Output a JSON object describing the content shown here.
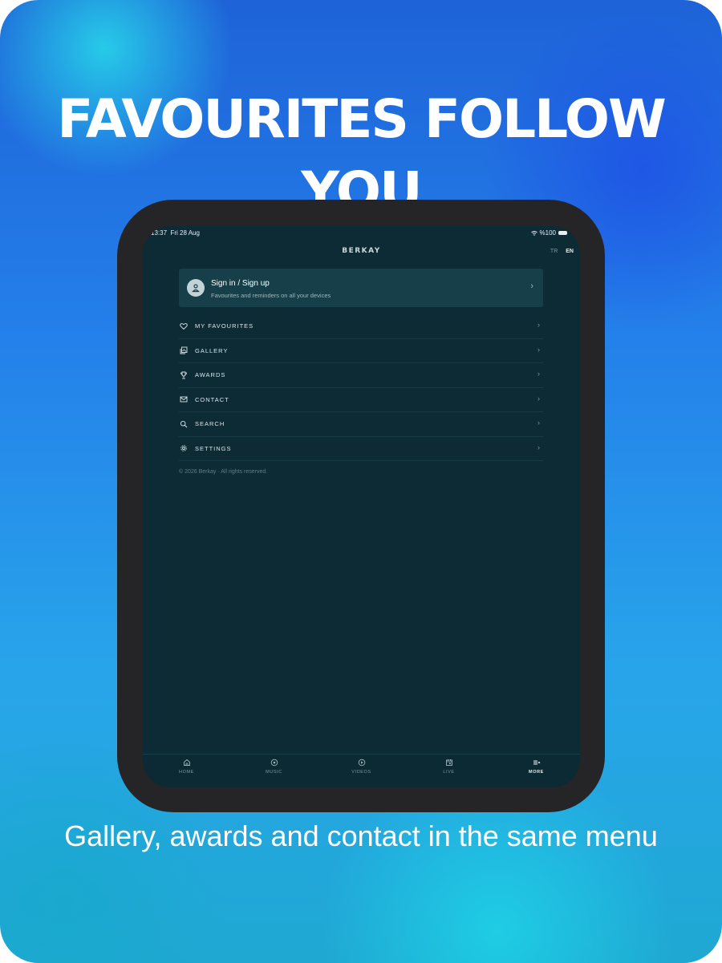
{
  "headline": "FAVOURITES FOLLOW YOU",
  "caption": "Gallery, awards and contact in the same menu",
  "colors": {
    "screen_bg": "#0d2b35",
    "device_frame": "#252527",
    "signin_bg": "#163f4a",
    "headline": "#ffffff"
  },
  "statusbar": {
    "time": "13:37",
    "date": "Fri 28 Aug",
    "battery": "%100"
  },
  "app": {
    "logo": "BERKAY",
    "languages": [
      {
        "code": "TR",
        "active": false
      },
      {
        "code": "EN",
        "active": true
      }
    ]
  },
  "signin": {
    "title": "Sign in / Sign up",
    "subtitle": "Favourites and reminders on all your devices"
  },
  "menu": [
    {
      "label": "MY FAVOURITES",
      "icon": "heart-icon"
    },
    {
      "label": "GALLERY",
      "icon": "gallery-icon"
    },
    {
      "label": "AWARDS",
      "icon": "trophy-icon"
    },
    {
      "label": "CONTACT",
      "icon": "mail-icon"
    },
    {
      "label": "SEARCH",
      "icon": "search-icon"
    },
    {
      "label": "SETTINGS",
      "icon": "gear-icon"
    }
  ],
  "footer_note": "© 2026 Berkay · All rights reserved.",
  "tabs": [
    {
      "label": "HOME",
      "icon": "home-icon",
      "active": false
    },
    {
      "label": "MUSIC",
      "icon": "music-icon",
      "active": false
    },
    {
      "label": "VIDEOS",
      "icon": "play-icon",
      "active": false
    },
    {
      "label": "LIVE",
      "icon": "calendar-icon",
      "active": false
    },
    {
      "label": "MORE",
      "icon": "menu-icon",
      "active": true
    }
  ]
}
